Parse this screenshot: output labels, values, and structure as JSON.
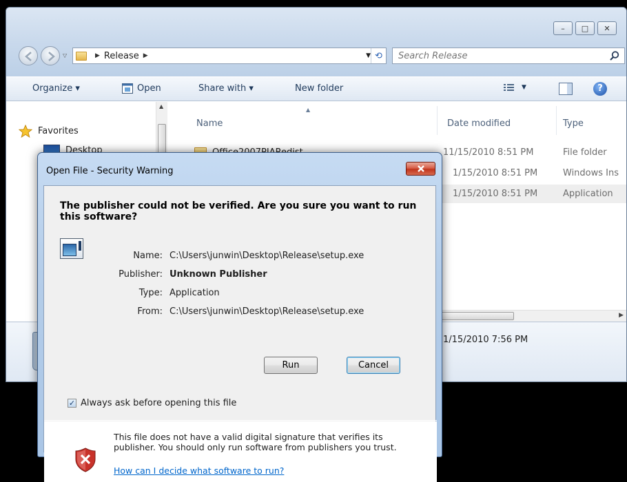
{
  "explorer": {
    "caption_buttons": [
      "–",
      "□",
      "✕"
    ],
    "address": {
      "path": [
        "Release"
      ],
      "placeholder": "Search Release"
    },
    "toolbar": {
      "organize": "Organize ▾",
      "open": "Open",
      "share": "Share with ▾",
      "new_folder": "New folder"
    },
    "nav_pane": {
      "favorites": "Favorites",
      "desktop": "Desktop"
    },
    "columns": {
      "name": "Name",
      "date": "Date modified",
      "type": "Type"
    },
    "files": [
      {
        "name": "Office2007PIARedist",
        "date": "11/15/2010 8:51 PM",
        "type": "File folder"
      },
      {
        "name": "",
        "date": "1/15/2010 8:51 PM",
        "type": "Windows Ins"
      },
      {
        "name": "",
        "date": "1/15/2010 8:51 PM",
        "type": "Application"
      }
    ],
    "details": {
      "date": "1/15/2010 7:56 PM"
    }
  },
  "dialog": {
    "title": "Open File - Security Warning",
    "heading": "The publisher could not be verified.  Are you sure you want to run this software?",
    "fields": [
      {
        "key": "Name:",
        "value": "C:\\Users\\junwin\\Desktop\\Release\\setup.exe",
        "bold": false
      },
      {
        "key": "Publisher:",
        "value": "Unknown Publisher",
        "bold": true
      },
      {
        "key": "Type:",
        "value": "Application",
        "bold": false
      },
      {
        "key": "From:",
        "value": "C:\\Users\\junwin\\Desktop\\Release\\setup.exe",
        "bold": false
      }
    ],
    "run_label": "Run",
    "cancel_label": "Cancel",
    "always_ask_label": "Always ask before opening this file",
    "always_ask_checked": true,
    "footer_text": "This file does not have a valid digital signature that verifies its publisher.  You should only run software from publishers you trust.",
    "help_link": "How can I decide what software to run?"
  }
}
